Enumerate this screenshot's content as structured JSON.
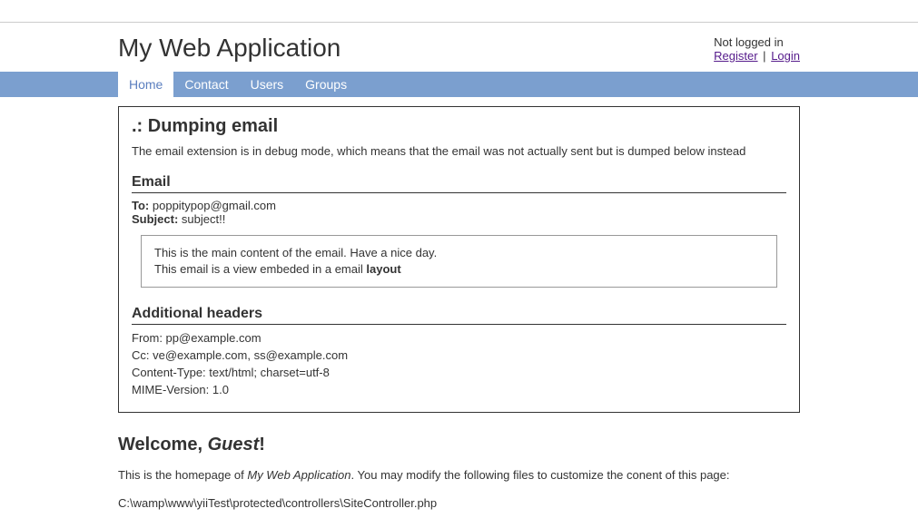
{
  "header": {
    "title": "My Web Application",
    "not_logged_in": "Not logged in",
    "register": "Register",
    "sep": "|",
    "login": "Login"
  },
  "menu": {
    "items": [
      {
        "label": "Home",
        "active": true
      },
      {
        "label": "Contact",
        "active": false
      },
      {
        "label": "Users",
        "active": false
      },
      {
        "label": "Groups",
        "active": false
      }
    ]
  },
  "dump": {
    "title": ".: Dumping email",
    "desc": "The email extension is in debug mode, which means that the email was not actually sent but is dumped below instead",
    "email_heading": "Email",
    "to_label": "To:",
    "to_value": "poppitypop@gmail.com",
    "subject_label": "Subject:",
    "subject_value": "subject!!",
    "body_line1": "This is the main content of the email. Have a nice day.",
    "body_line2_prefix": "This email is a view embeded in a email ",
    "body_line2_bold": "layout",
    "additional_heading": "Additional headers",
    "headers": [
      "From: pp@example.com",
      "Cc: ve@example.com, ss@example.com",
      "Content-Type: text/html; charset=utf-8",
      "MIME-Version: 1.0"
    ]
  },
  "welcome": {
    "prefix": "Welcome, ",
    "name": "Guest",
    "suffix": "!"
  },
  "homepage": {
    "prefix": "This is the homepage of ",
    "appname": "My Web Application",
    "suffix": ". You may modify the following files to customize the conent of this page:",
    "filepath": "C:\\wamp\\www\\yiiTest\\protected\\controllers\\SiteController.php"
  }
}
